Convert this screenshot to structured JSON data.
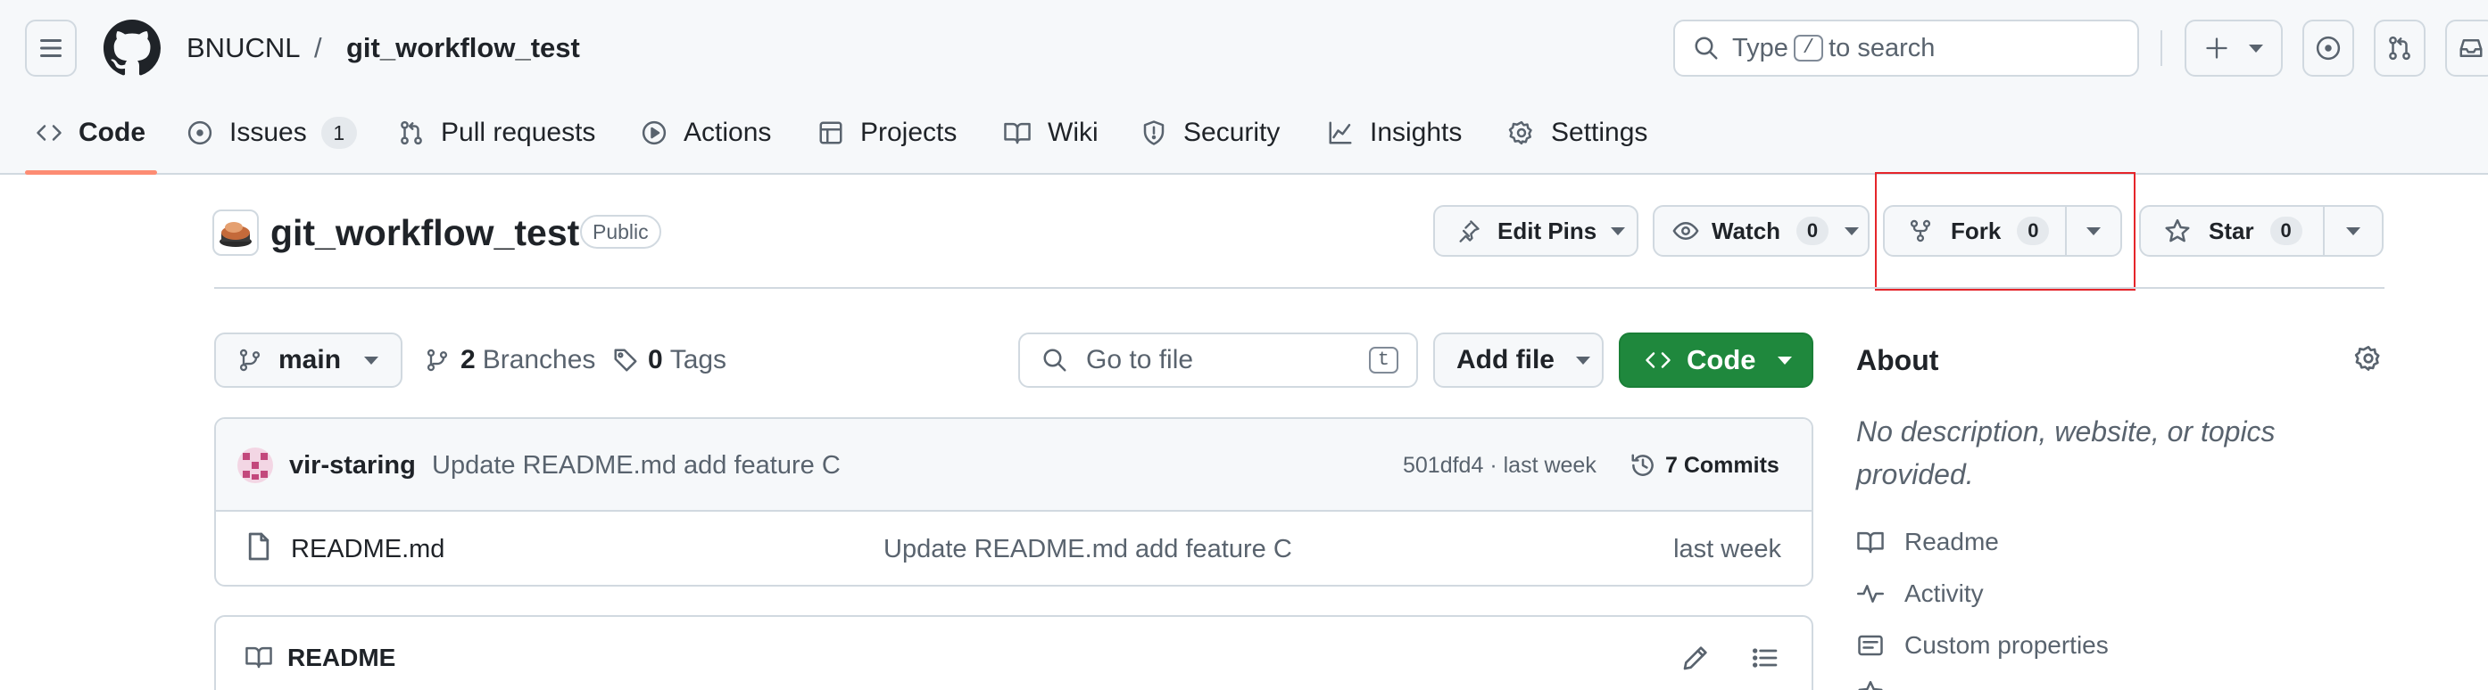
{
  "header": {
    "owner": "BNUCNL",
    "separator": "/",
    "repo": "git_workflow_test",
    "search": {
      "prefix": "Type",
      "key": "/",
      "suffix": "to search"
    },
    "icons": [
      "menu-icon",
      "github-logo-icon",
      "search-icon",
      "plus-icon",
      "issues-icon",
      "pull-request-icon",
      "inbox-icon"
    ]
  },
  "tabs": [
    {
      "label": "Code",
      "icon": "code-icon",
      "selected": true
    },
    {
      "label": "Issues",
      "icon": "issue-opened-icon",
      "count": "1"
    },
    {
      "label": "Pull requests",
      "icon": "git-pull-request-icon"
    },
    {
      "label": "Actions",
      "icon": "play-icon"
    },
    {
      "label": "Projects",
      "icon": "table-icon"
    },
    {
      "label": "Wiki",
      "icon": "book-icon"
    },
    {
      "label": "Security",
      "icon": "shield-icon"
    },
    {
      "label": "Insights",
      "icon": "graph-icon"
    },
    {
      "label": "Settings",
      "icon": "gear-icon"
    }
  ],
  "repo_header": {
    "name": "git_workflow_test",
    "visibility": "Public",
    "edit_pins": "Edit Pins",
    "watch": {
      "label": "Watch",
      "count": "0"
    },
    "fork": {
      "label": "Fork",
      "count": "0"
    },
    "star": {
      "label": "Star",
      "count": "0"
    },
    "highlight_color": "#e5252a"
  },
  "file_nav": {
    "branch": "main",
    "branches": {
      "count": "2",
      "label": "Branches"
    },
    "tags": {
      "count": "0",
      "label": "Tags"
    },
    "goto_placeholder": "Go to file",
    "goto_key": "t",
    "add_file": "Add file",
    "code": "Code",
    "code_color": "#1f883d"
  },
  "latest_commit": {
    "author": "vir-staring",
    "message": "Update README.md add feature C",
    "sha": "501dfd4",
    "dot": "·",
    "time": "last week",
    "commits": "7 Commits"
  },
  "files": [
    {
      "name": "README.md",
      "message": "Update README.md add feature C",
      "time": "last week"
    }
  ],
  "readme": {
    "title": "README"
  },
  "about": {
    "title": "About",
    "description": "No description, website, or topics provided.",
    "items": [
      {
        "label": "Readme",
        "icon": "book-icon"
      },
      {
        "label": "Activity",
        "icon": "pulse-icon"
      },
      {
        "label": "Custom properties",
        "icon": "note-icon"
      }
    ]
  }
}
